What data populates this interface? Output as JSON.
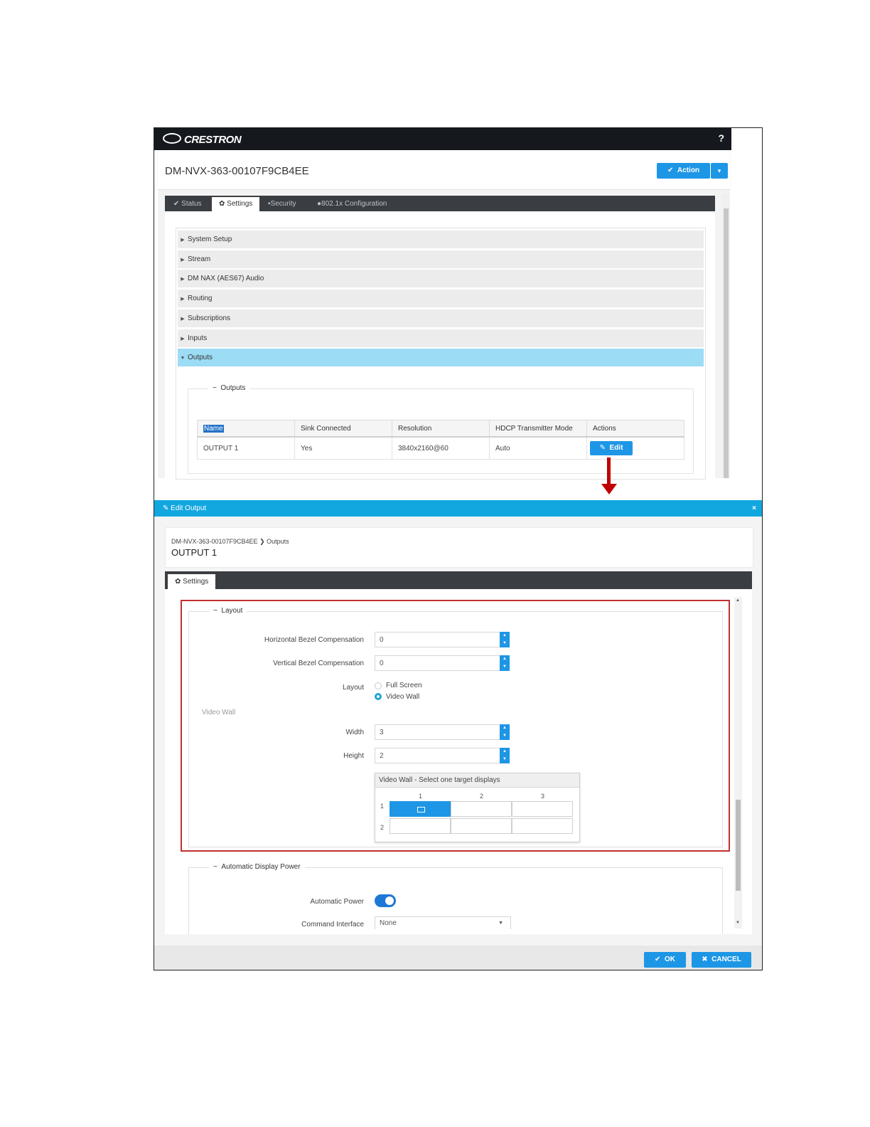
{
  "app": {
    "brand": "CRESTRON",
    "help_label": "?",
    "device_title": "DM-NVX-363-00107F9CB4EE",
    "action_label": "Action",
    "action_caret": "▾"
  },
  "tabs": [
    {
      "icon": "✔",
      "label": "Status"
    },
    {
      "icon": "✿",
      "label": "Settings"
    },
    {
      "icon": "🔒",
      "label": "Security"
    },
    {
      "icon": "●",
      "label": "802.1x Configuration"
    }
  ],
  "accordion": [
    {
      "label": "System Setup"
    },
    {
      "label": "Stream"
    },
    {
      "label": "DM NAX (AES67) Audio"
    },
    {
      "label": "Routing"
    },
    {
      "label": "Subscriptions"
    },
    {
      "label": "Inputs"
    },
    {
      "label": "Outputs"
    }
  ],
  "outputs_section": {
    "legend": "Outputs",
    "columns": [
      "Name",
      "Sink Connected",
      "Resolution",
      "HDCP Transmitter Mode",
      "Actions"
    ],
    "rows": [
      {
        "name": "OUTPUT 1",
        "sink": "Yes",
        "resolution": "3840x2160@60",
        "hdcp": "Auto",
        "action": "Edit"
      }
    ]
  },
  "modal": {
    "title": "Edit Output",
    "close": "×",
    "breadcrumb_device": "DM-NVX-363-00107F9CB4EE",
    "breadcrumb_sep": "❯",
    "breadcrumb_section": "Outputs",
    "output_name": "OUTPUT 1",
    "tab": "Settings",
    "layout": {
      "legend": "Layout",
      "h_bezel_label": "Horizontal Bezel Compensation",
      "h_bezel_value": "0",
      "v_bezel_label": "Vertical Bezel Compensation",
      "v_bezel_value": "0",
      "layout_label": "Layout",
      "options": [
        "Full Screen",
        "Video Wall"
      ],
      "selected": "Video Wall",
      "video_wall_sub": "Video Wall",
      "width_label": "Width",
      "width_value": "3",
      "height_label": "Height",
      "height_value": "2",
      "grid_title": "Video Wall - Select one target displays",
      "grid_cols": [
        "1",
        "2",
        "3"
      ],
      "grid_rows": [
        "1",
        "2"
      ],
      "selected_cell": [
        1,
        1
      ]
    },
    "power": {
      "legend": "Automatic Display Power",
      "auto_power_label": "Automatic Power",
      "auto_power_on": true,
      "cmd_label": "Command Interface",
      "cmd_value": "None"
    },
    "ok_label": "OK",
    "cancel_label": "CANCEL"
  },
  "colors": {
    "accent": "#1e96e6",
    "modal_header": "#13a7e0",
    "highlight_row": "#9cdcf5",
    "callout": "#c00000"
  }
}
